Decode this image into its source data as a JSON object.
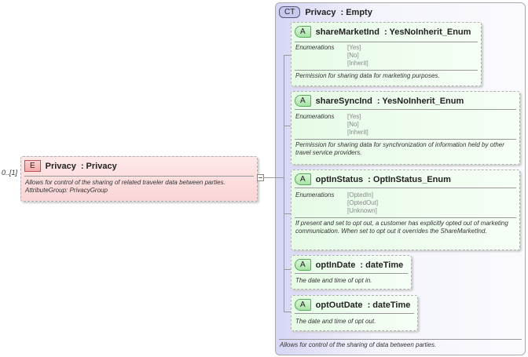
{
  "element": {
    "cardinality": "0..[1]",
    "badge": "E",
    "name": "Privacy",
    "type": ": Privacy",
    "description": [
      "Allows for control of the sharing of related traveler data between parties.",
      "AttributeGroup: PrivacyGroup"
    ]
  },
  "complex_type": {
    "badge": "CT",
    "name": "Privacy",
    "type": ": Empty",
    "footer": "Allows for control of the sharing of data between parties."
  },
  "attributes": [
    {
      "badge": "A",
      "name": "shareMarketInd",
      "type": ": YesNoInherit_Enum",
      "enum_label": "Enumerations",
      "enums": "[Yes]\n[No]\n[Inherit]",
      "description": "Permission for sharing data for marketing purposes."
    },
    {
      "badge": "A",
      "name": "shareSyncInd",
      "type": ": YesNoInherit_Enum",
      "enum_label": "Enumerations",
      "enums": "[Yes]\n[No]\n[Inherit]",
      "description": "Permission for sharing data for synchronization of information held by other travel service providers."
    },
    {
      "badge": "A",
      "name": "optInStatus",
      "type": ": OptInStatus_Enum",
      "enum_label": "Enumerations",
      "enums": "[OptedIn]\n[OptedOut]\n[Unknown]",
      "description": "If present and set to opt out, a customer has explicitly opted out of marketing communication. When set to opt out it overrides the ShareMarketInd."
    },
    {
      "badge": "A",
      "name": "optInDate",
      "type": ": dateTime",
      "description": "The date and time of opt in."
    },
    {
      "badge": "A",
      "name": "optOutDate",
      "type": ": dateTime",
      "description": "The date and time of opt out."
    }
  ]
}
